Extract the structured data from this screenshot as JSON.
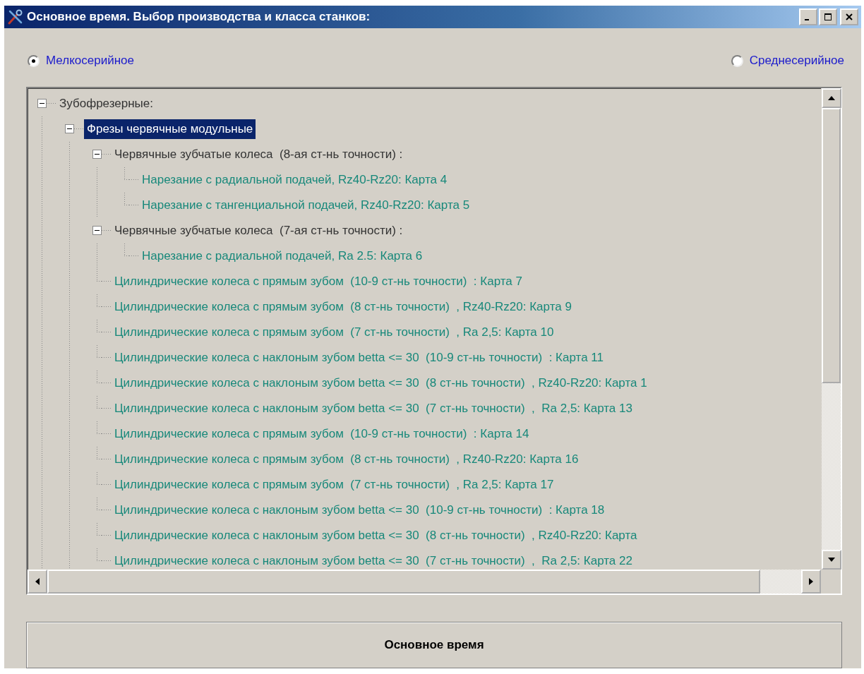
{
  "window": {
    "title": "Основное время. Выбор производства и класса  станков:"
  },
  "production_types": [
    {
      "label": "Мелкосерийное",
      "selected": true
    },
    {
      "label": "Среднесерийное",
      "selected": false
    }
  ],
  "tree": [
    {
      "kind": "group",
      "label": "Зубофрезерные:",
      "expanded": true,
      "selected": false,
      "children": [
        {
          "kind": "group",
          "label": "Фрезы червячные модульные",
          "expanded": true,
          "selected": true,
          "children": [
            {
              "kind": "group",
              "label": "Червячные зубчатые колеса  (8-ая ст-нь точности) :",
              "expanded": true,
              "selected": false,
              "children": [
                {
                  "kind": "leaf",
                  "label": "Нарезание с радиальной подачей, Rz40-Rz20: Карта 4",
                  "selected": false
                },
                {
                  "kind": "leaf",
                  "label": "Нарезание с тангенциальной подачей, Rz40-Rz20: Карта 5",
                  "selected": false
                }
              ]
            },
            {
              "kind": "group",
              "label": "Червячные зубчатые колеса  (7-ая ст-нь точности) :",
              "expanded": true,
              "selected": false,
              "children": [
                {
                  "kind": "leaf",
                  "label": "Нарезание с радиальной подачей, Ra 2.5: Карта 6",
                  "selected": false
                }
              ]
            },
            {
              "kind": "leaf",
              "label": "Цилиндрические колеса с прямым зубом  (10-9 ст-нь точности)  : Карта 7",
              "selected": false
            },
            {
              "kind": "leaf",
              "label": "Цилиндрические колеса с прямым зубом  (8 ст-нь точности)  , Rz40-Rz20: Карта 9",
              "selected": false
            },
            {
              "kind": "leaf",
              "label": "Цилиндрические колеса с прямым зубом  (7 ст-нь точности)  , Ra 2,5: Карта 10",
              "selected": false
            },
            {
              "kind": "leaf",
              "label": "Цилиндрические колеса с наклоным зубом betta <= 30  (10-9 ст-нь точности)  : Карта 11",
              "selected": false
            },
            {
              "kind": "leaf",
              "label": "Цилиндрические колеса с наклоным зубом betta <= 30  (8 ст-нь точности)  , Rz40-Rz20: Карта 1",
              "selected": false
            },
            {
              "kind": "leaf",
              "label": "Цилиндрические колеса с наклоным зубом betta <= 30  (7 ст-нь точности)  ,  Ra 2,5: Карта 13",
              "selected": false
            },
            {
              "kind": "leaf",
              "label": "Цилиндрические колеса с прямым зубом  (10-9 ст-нь точности)  : Карта 14",
              "selected": false
            },
            {
              "kind": "leaf",
              "label": "Цилиндрические колеса с прямым зубом  (8 ст-нь точности)  , Rz40-Rz20: Карта 16",
              "selected": false
            },
            {
              "kind": "leaf",
              "label": "Цилиндрические колеса с прямым зубом  (7 ст-нь точности)  , Ra 2,5: Карта 17",
              "selected": false
            },
            {
              "kind": "leaf",
              "label": "Цилиндрические колеса с наклоным зубом betta <= 30  (10-9 ст-нь точности)  : Карта 18",
              "selected": false
            },
            {
              "kind": "leaf",
              "label": "Цилиндрические колеса с наклоным зубом betta <= 30  (8 ст-нь точности)  , Rz40-Rz20: Карта",
              "selected": false
            },
            {
              "kind": "leaf",
              "label": "Цилиндрические колеса с наклоным зубом betta <= 30  (7 ст-нь точности)  ,  Ra 2,5: Карта 22",
              "selected": false
            }
          ]
        }
      ]
    }
  ],
  "action_button": "Основное время"
}
